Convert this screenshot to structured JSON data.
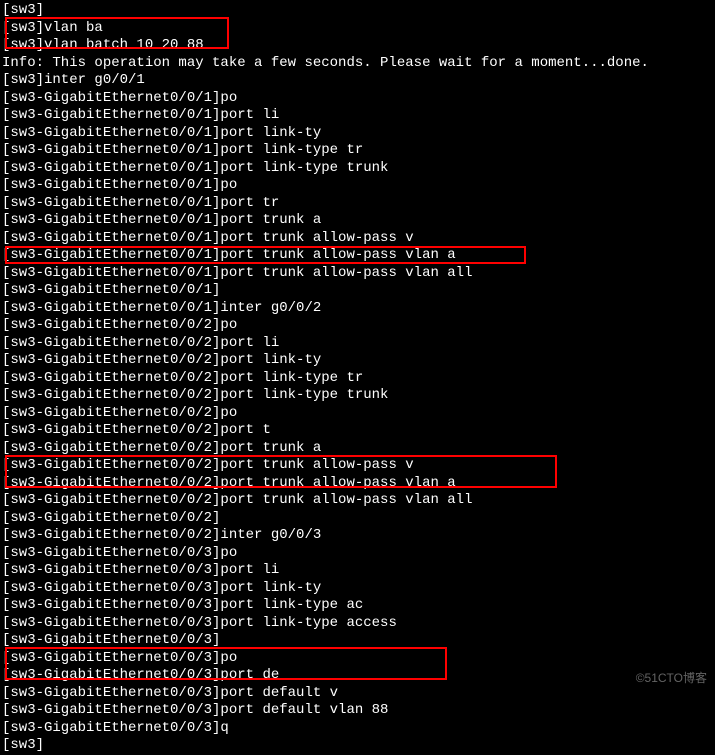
{
  "lines": [
    "[sw3]",
    "[sw3]vlan ba",
    "[sw3]vlan batch 10 20 88",
    "Info: This operation may take a few seconds. Please wait for a moment...done.",
    "[sw3]inter g0/0/1",
    "[sw3-GigabitEthernet0/0/1]po",
    "[sw3-GigabitEthernet0/0/1]port li",
    "[sw3-GigabitEthernet0/0/1]port link-ty",
    "[sw3-GigabitEthernet0/0/1]port link-type tr",
    "[sw3-GigabitEthernet0/0/1]port link-type trunk",
    "[sw3-GigabitEthernet0/0/1]po",
    "[sw3-GigabitEthernet0/0/1]port tr",
    "[sw3-GigabitEthernet0/0/1]port trunk a",
    "[sw3-GigabitEthernet0/0/1]port trunk allow-pass v",
    "[sw3-GigabitEthernet0/0/1]port trunk allow-pass vlan a",
    "[sw3-GigabitEthernet0/0/1]port trunk allow-pass vlan all",
    "[sw3-GigabitEthernet0/0/1]",
    "[sw3-GigabitEthernet0/0/1]inter g0/0/2",
    "[sw3-GigabitEthernet0/0/2]po",
    "[sw3-GigabitEthernet0/0/2]port li",
    "[sw3-GigabitEthernet0/0/2]port link-ty",
    "[sw3-GigabitEthernet0/0/2]port link-type tr",
    "[sw3-GigabitEthernet0/0/2]port link-type trunk",
    "[sw3-GigabitEthernet0/0/2]po",
    "[sw3-GigabitEthernet0/0/2]port t",
    "[sw3-GigabitEthernet0/0/2]port trunk a",
    "[sw3-GigabitEthernet0/0/2]port trunk allow-pass v",
    "[sw3-GigabitEthernet0/0/2]port trunk allow-pass vlan a",
    "[sw3-GigabitEthernet0/0/2]port trunk allow-pass vlan all",
    "[sw3-GigabitEthernet0/0/2]",
    "[sw3-GigabitEthernet0/0/2]inter g0/0/3",
    "[sw3-GigabitEthernet0/0/3]po",
    "[sw3-GigabitEthernet0/0/3]port li",
    "[sw3-GigabitEthernet0/0/3]port link-ty",
    "[sw3-GigabitEthernet0/0/3]port link-type ac",
    "[sw3-GigabitEthernet0/0/3]port link-type access",
    "[sw3-GigabitEthernet0/0/3]",
    "[sw3-GigabitEthernet0/0/3]po",
    "[sw3-GigabitEthernet0/0/3]port de",
    "[sw3-GigabitEthernet0/0/3]port default v",
    "[sw3-GigabitEthernet0/0/3]port default vlan 88",
    "[sw3-GigabitEthernet0/0/3]q",
    "[sw3]"
  ],
  "watermark": "©51CTO博客"
}
